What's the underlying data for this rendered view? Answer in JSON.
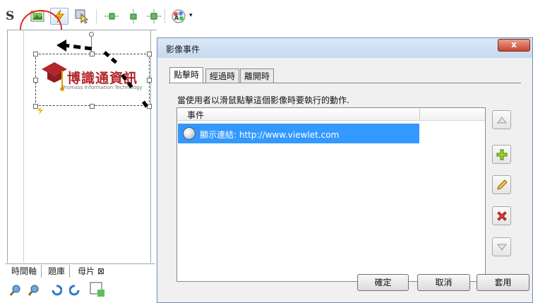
{
  "toolbar": {
    "logo_letter": "S",
    "icons": [
      "image-icon",
      "lightning-event-icon",
      "pointer-select-icon",
      "align-horizontal-icon",
      "align-vertical-icon",
      "distribute-icon",
      "color-palette-icon",
      "dropdown-arrow-icon"
    ]
  },
  "canvas": {
    "logo_text": "博識通資訊",
    "logo_subtext": "Promass Information Technology"
  },
  "bottom_tabs": [
    "時間軸",
    "題庫",
    "母片 ⊠"
  ],
  "dialog": {
    "title": "影像事件",
    "close_label": "x",
    "tabs": [
      "點擊時",
      "經過時",
      "離開時"
    ],
    "active_tab": 0,
    "description": "當使用者以滑鼠點擊這個影像時要執行的動作.",
    "list_header": "事件",
    "rows": [
      {
        "text": "顯示連結: http://www.viewlet.com",
        "selected": true
      }
    ],
    "buttons": {
      "ok": "確定",
      "cancel": "取消",
      "apply": "套用"
    },
    "side_buttons": [
      "move-up-icon",
      "add-icon",
      "edit-icon",
      "delete-icon",
      "move-down-icon"
    ]
  },
  "colors": {
    "selection": "#3399ff",
    "annotation_red": "#e32a2a",
    "logo_red": "#b3262b"
  }
}
